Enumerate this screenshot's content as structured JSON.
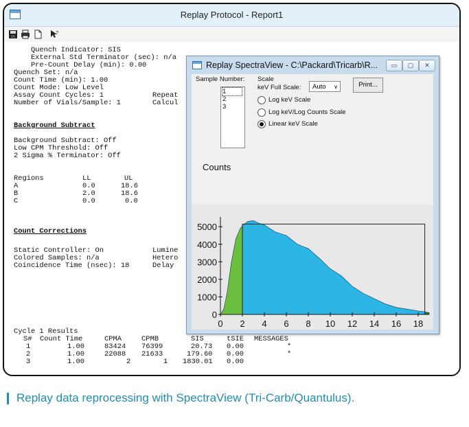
{
  "window": {
    "title": "Replay Protocol - Report1"
  },
  "toolbar": {
    "icons": [
      "save-icon",
      "print-icon",
      "page-icon",
      "help-pointer-icon"
    ]
  },
  "report": {
    "lines": [
      "    Quench Indicator: SIS",
      "    External Std Terminator (sec): n/a",
      "    Pre-Count Delay (min): 0.00",
      "Quench Set: n/a",
      "Count Time (min): 1.00",
      "Count Mode: Low Level",
      "Assay Count Cycles: 1",
      "Number of Vials/Sample: 1",
      "Background Subtract: Off",
      "Low CPM Threshold: Off",
      "2 Sigma % Terminator: Off",
      "Static Controller: On",
      "Colored Samples: n/a",
      "Coincidence Time (nsec): 18"
    ],
    "right_fragments": [
      "Repeat",
      "Calcul",
      "Lumine",
      "Hetero",
      "Delay "
    ],
    "sections": {
      "background": "Background Subtract",
      "corrections": "Count Corrections"
    },
    "regions": {
      "header": [
        "Regions",
        "LL",
        "UL"
      ],
      "rows": [
        [
          "A",
          "0.0",
          "18.6"
        ],
        [
          "B",
          "2.0",
          "18.6"
        ],
        [
          "C",
          "0.0",
          "0.0"
        ]
      ]
    },
    "cycle": {
      "title": "Cycle 1 Results",
      "header": [
        "S#",
        "Count Time",
        "CPMA",
        "CPMB",
        "SIS",
        "tSIE",
        "MESSAGES"
      ],
      "rows": [
        [
          "1",
          "1.00",
          "83424",
          "76399",
          "20.73",
          "0.00",
          "*"
        ],
        [
          "2",
          "1.00",
          "22088",
          "21633",
          "179.60",
          "0.00",
          "*"
        ],
        [
          "3",
          "1.00",
          "2",
          "1",
          "1830.01",
          "0.00",
          ""
        ]
      ]
    }
  },
  "spectra": {
    "title": "Replay SpectraView - C:\\Packard\\Tricarb\\R...",
    "controls": {
      "minimize": "▭",
      "maximize": "▢",
      "close": "✕"
    },
    "sample_label": "Sample Number:",
    "samples": [
      "1",
      "2",
      "3"
    ],
    "selected_sample": "1",
    "scale_label": "Scale",
    "full_scale_label": "keV Full Scale:",
    "full_scale_value": "Auto",
    "print_label": "Print...",
    "options": [
      {
        "label": "Log keV Scale",
        "selected": false
      },
      {
        "label": "Log keV/Log Counts Scale",
        "selected": false
      },
      {
        "label": "Linear keV Scale",
        "selected": true
      }
    ],
    "counts_label": "Counts"
  },
  "chart_data": {
    "type": "area",
    "title": "",
    "ylabel": "Counts",
    "xlabel": "",
    "xlim": [
      0,
      19
    ],
    "ylim": [
      0,
      5400
    ],
    "xticks": [
      "0",
      "2",
      "4",
      "6",
      "8",
      "10",
      "12",
      "14",
      "16",
      "18"
    ],
    "yticks": [
      "0",
      "1000",
      "2000",
      "3000",
      "4000",
      "5000"
    ],
    "region_marker_x": [
      2,
      18.6
    ],
    "region_marker_y": 5150,
    "series": [
      {
        "color": "#6abf3c",
        "x": [
          0,
          0.3,
          0.6,
          1.0,
          1.4,
          1.8,
          2.0
        ],
        "y": [
          0,
          300,
          1200,
          3000,
          4300,
          4900,
          5050
        ]
      },
      {
        "color": "#2db5e6",
        "x": [
          2.0,
          2.5,
          3.0,
          3.5,
          4.0,
          5.0,
          6.0,
          7.0,
          8.0,
          9.0,
          10.0,
          11.0,
          12.0,
          13.0,
          14.0,
          15.0,
          16.0,
          17.0,
          18.0,
          18.6
        ],
        "y": [
          5050,
          5300,
          5350,
          5200,
          5100,
          4700,
          4500,
          4000,
          3750,
          3200,
          2600,
          2200,
          1600,
          1200,
          900,
          600,
          400,
          300,
          200,
          150
        ]
      },
      {
        "color": "#118822",
        "x": [
          18.6,
          18.8,
          19.0
        ],
        "y": [
          150,
          120,
          100
        ]
      }
    ]
  },
  "caption": "Replay data reprocessing with SpectraView (Tri-Carb/Quantulus)."
}
